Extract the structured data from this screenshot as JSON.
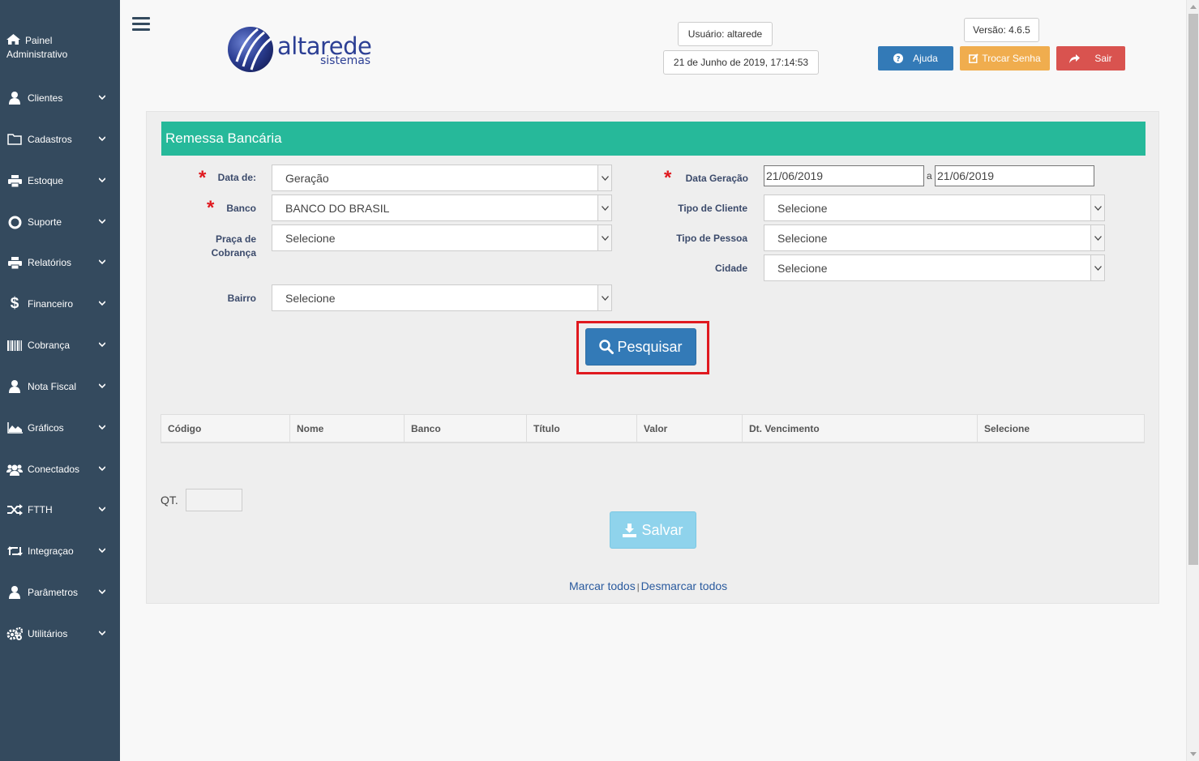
{
  "sidebar": {
    "home_line1": "Painel",
    "home_line2": "Administrativo",
    "items": [
      {
        "label": "Clientes",
        "icon": "user-icon"
      },
      {
        "label": "Cadastros",
        "icon": "folder-icon"
      },
      {
        "label": "Estoque",
        "icon": "print-icon"
      },
      {
        "label": "Suporte",
        "icon": "lifebuoy-icon"
      },
      {
        "label": "Relatórios",
        "icon": "print-icon"
      },
      {
        "label": "Financeiro",
        "icon": "dollar-icon"
      },
      {
        "label": "Cobrança",
        "icon": "barcode-icon"
      },
      {
        "label": "Nota Fiscal",
        "icon": "user-icon"
      },
      {
        "label": "Gráficos",
        "icon": "area-chart-icon"
      },
      {
        "label": "Conectados",
        "icon": "users-icon"
      },
      {
        "label": "FTTH",
        "icon": "random-icon"
      },
      {
        "label": "Integraçao",
        "icon": "retweet-icon"
      },
      {
        "label": "Parâmetros",
        "icon": "user-icon"
      },
      {
        "label": "Utilitários",
        "icon": "cogs-icon"
      }
    ]
  },
  "header": {
    "logo_text": "altarede",
    "logo_sub": "sistemas",
    "user": "Usuário: altarede",
    "datetime": "21 de Junho de 2019, 17:14:53",
    "version": "Versão: 4.6.5",
    "help_label": "Ajuda",
    "change_password_label": "Trocar Senha",
    "logout_label": "Sair",
    "colors": {
      "help": "#337ab7",
      "change_password": "#f0ad4e",
      "logout": "#d9534f"
    }
  },
  "form": {
    "title": "Remessa Bancária",
    "data_de_label": "Data de:",
    "data_de_value": "Geração",
    "banco_label": "Banco",
    "banco_value": "BANCO DO BRASIL",
    "praca_label_1": "Praça de",
    "praca_label_2": "Cobrança",
    "praca_value": "Selecione",
    "bairro_label": "Bairro",
    "bairro_value": "Selecione",
    "data_geracao_label": "Data Geração",
    "data_geracao_from": "21/06/2019",
    "data_geracao_sep": "a",
    "data_geracao_to": "21/06/2019",
    "tipo_cliente_label": "Tipo de Cliente",
    "tipo_cliente_value": "Selecione",
    "tipo_pessoa_label": "Tipo de Pessoa",
    "tipo_pessoa_value": "Selecione",
    "cidade_label": "Cidade",
    "cidade_value": "Selecione",
    "search_label": "Pesquisar"
  },
  "table": {
    "columns": [
      "Código",
      "Nome",
      "Banco",
      "Título",
      "Valor",
      "Dt. Vencimento",
      "Selecione"
    ]
  },
  "footer": {
    "qt_label": "QT.",
    "qt_value": "",
    "save_label": "Salvar",
    "mark_all": "Marcar todos",
    "separator": "|",
    "unmark_all": "Desmarcar todos"
  }
}
